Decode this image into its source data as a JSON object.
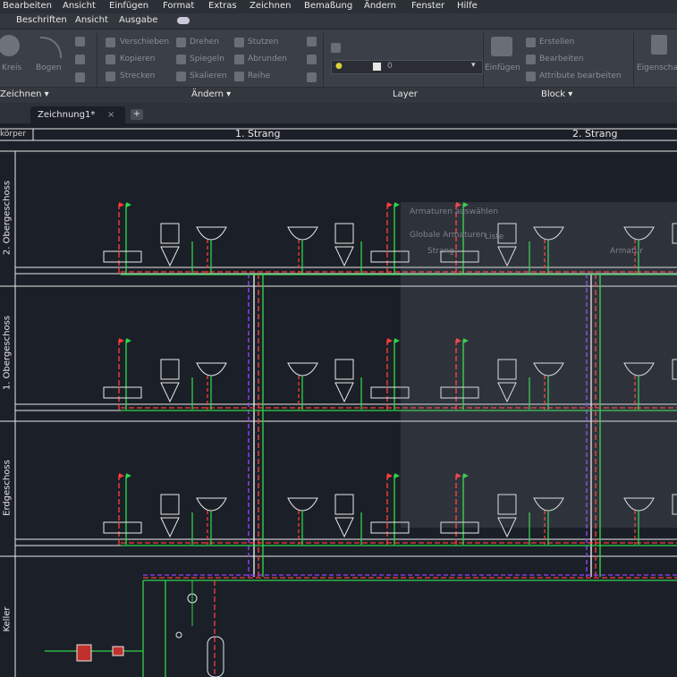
{
  "menu": [
    "Bearbeiten",
    "Ansicht",
    "Einfügen",
    "Format",
    "Extras",
    "Zeichnen",
    "Bemaßung",
    "Ändern",
    "Fenster",
    "Hilfe"
  ],
  "quickbar": [
    "Beschriften",
    "Ansicht",
    "Ausgabe"
  ],
  "ribbon": {
    "panels": [
      "Zeichnen",
      "Ändern",
      "Layer",
      "Block"
    ],
    "tools": [
      "Kreis",
      "Bogen",
      "Verschieben",
      "Drehen",
      "Stutzen",
      "Kopieren",
      "Spiegeln",
      "Abrunden",
      "Strecken",
      "Skalieren",
      "Reihe",
      "Einfügen",
      "Erstellen",
      "Bearbeiten",
      "Attribute bearbeiten",
      "Eigenschaften anpassen"
    ],
    "layer_value": "0"
  },
  "doc_tab": {
    "label": "Zeichnung1*",
    "close": "×",
    "new": "+"
  },
  "drawing": {
    "header_left": "körper",
    "strang_labels": [
      "1. Strang",
      "2. Strang"
    ],
    "floors": [
      "2. Obergeschoss",
      "1. Obergeschoss",
      "Erdgeschoss",
      "Keller"
    ]
  },
  "ghost_dialog": {
    "title": "Armaturen auswählen",
    "rows": [
      "Globale Armaturen",
      "Liste",
      "Strang",
      "Armatur"
    ]
  },
  "colors": {
    "background": "#1b1f27",
    "red": "#ff3b3b",
    "green": "#2fd24a",
    "purple": "#9a3cff",
    "white": "#e8e8e8"
  }
}
